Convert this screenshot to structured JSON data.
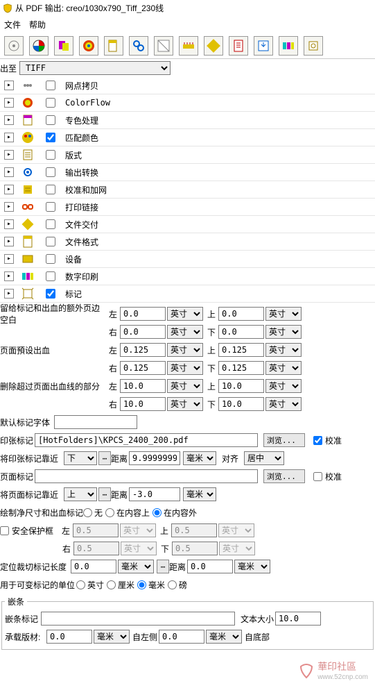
{
  "window": {
    "title_prefix": "从 PDF 输出:",
    "title_path": "creo/1030x790_Tiff_230线"
  },
  "menu": {
    "file": "文件",
    "help": "帮助"
  },
  "output_to": {
    "label": "出至",
    "value": "TIFF"
  },
  "tree": [
    {
      "checked": false,
      "label": "网点拷贝"
    },
    {
      "checked": false,
      "label": "ColorFlow"
    },
    {
      "checked": false,
      "label": "专色处理"
    },
    {
      "checked": true,
      "label": "匹配颜色"
    },
    {
      "checked": false,
      "label": "版式"
    },
    {
      "checked": false,
      "label": "输出转换"
    },
    {
      "checked": false,
      "label": "校准和加网"
    },
    {
      "checked": false,
      "label": "打印链接"
    },
    {
      "checked": false,
      "label": "文件交付"
    },
    {
      "checked": false,
      "label": "文件格式"
    },
    {
      "checked": false,
      "label": "设备"
    },
    {
      "checked": false,
      "label": "数字印刷"
    },
    {
      "checked": true,
      "label": "标记"
    }
  ],
  "margins": {
    "label_extra_edge": "留给标记和出血的额外页边空白",
    "label_preset_bleed": "页面預设出血",
    "label_remove_beyond": "删除超过页面出血线的部分",
    "sides": {
      "left": "左",
      "right": "右",
      "top": "上",
      "bottom": "下"
    },
    "unit_inch": "英寸",
    "extra_left": "0.0",
    "extra_right": "0.0",
    "extra_top": "0.0",
    "extra_bottom": "0.0",
    "preset_left": "0.125",
    "preset_right": "0.125",
    "preset_top": "0.125",
    "preset_bottom": "0.125",
    "remove_left": "10.0",
    "remove_right": "10.0",
    "remove_top": "10.0",
    "remove_bottom": "10.0"
  },
  "default_mark_font": {
    "label": "默认标记字体",
    "value": ""
  },
  "sheet_mark": {
    "label": "印张标记",
    "path": "[HotFolders]\\KPCS_2400_200.pdf",
    "browse": "浏览...",
    "calibrate": "校准",
    "calibrate_checked": true
  },
  "sheet_mark_align": {
    "label": "将印张标记靠近",
    "position": "下",
    "distance_label": "距离",
    "distance": "9.9999999",
    "unit": "毫米",
    "align_label": "对齐",
    "align": "居中"
  },
  "page_mark": {
    "label": "页面标记",
    "value": "",
    "browse": "浏览...",
    "calibrate": "校准",
    "calibrate_checked": false
  },
  "page_mark_align": {
    "label": "将页面标记靠近",
    "position": "上",
    "distance_label": "距离",
    "distance": "-3.0",
    "unit": "毫米"
  },
  "draw_marks": {
    "label": "绘制净尺寸和出血标记",
    "none": "无",
    "inside": "在内容上",
    "outside": "在内容外"
  },
  "safe_box": {
    "label": "安全保护框",
    "checked": false,
    "left": "0.5",
    "right": "0.5",
    "top": "0.5",
    "bottom": "0.5",
    "unit": "英寸"
  },
  "trim_mark": {
    "label": "定位裁切标记长度",
    "length": "0.0",
    "unit": "毫米",
    "distance_label": "距离",
    "distance": "0.0"
  },
  "variable_unit": {
    "label": "用于可变标记的单位",
    "inch": "英寸",
    "cm": "厘米",
    "mm": "毫米",
    "pt": "磅"
  },
  "slug": {
    "legend": "嵌条",
    "mark_label": "嵌条标记",
    "mark_value": "",
    "text_size_label": "文本大小",
    "text_size": "10.0",
    "carrier_label": "承载版材:",
    "carrier_value": "0.0",
    "unit": "毫米",
    "from_left_label": "自左侧",
    "from_left": "0.0",
    "from_bottom_label": "自底部"
  },
  "watermark": {
    "text": "華印社區",
    "url": "www.52cnp.com"
  },
  "icons": {
    "tree": [
      "dots",
      "circle",
      "page",
      "palette",
      "page2",
      "gear",
      "sliders",
      "link",
      "stamp",
      "doc",
      "device",
      "rgb",
      "marks"
    ]
  }
}
